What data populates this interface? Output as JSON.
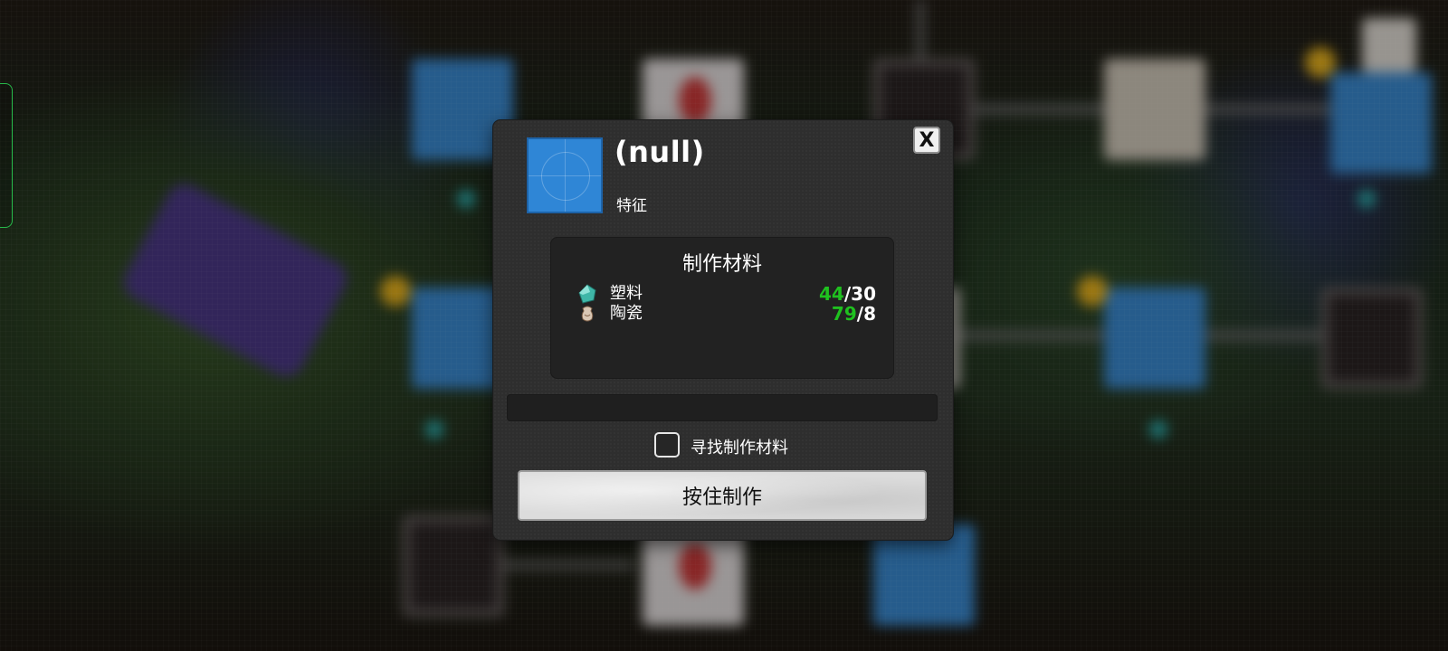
{
  "dialog": {
    "item_title": "(null)",
    "item_subtitle": "特征",
    "close_label": "X",
    "materials": {
      "title": "制作材料",
      "items": [
        {
          "name": "塑料",
          "have": "44",
          "need": "30",
          "icon": "plastic-icon"
        },
        {
          "name": "陶瓷",
          "have": "79",
          "need": "8",
          "icon": "ceramic-icon"
        }
      ]
    },
    "craft_progress": 0,
    "find_materials": {
      "label": "寻找制作材料",
      "checked": false
    },
    "hold_button_label": "按住制作"
  },
  "colors": {
    "have_color": "#1fc11f",
    "item_icon": "#2f86d6",
    "panel": "#2e2e2e"
  }
}
